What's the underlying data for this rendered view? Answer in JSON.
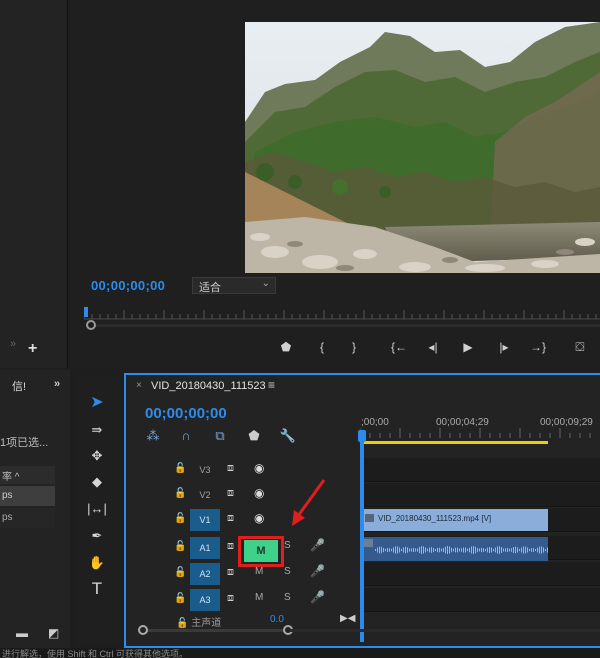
{
  "program_monitor": {
    "timecode": "00;00;00;00",
    "fit_label": "适合",
    "transport": [
      "marker-icon",
      "in-point-icon",
      "out-point-icon",
      "go-to-in-icon",
      "step-back-icon",
      "play-icon",
      "step-forward-icon",
      "go-to-out-icon",
      "export-frame-icon"
    ]
  },
  "project_panel": {
    "title": "信!",
    "selection": "1项已选...",
    "header": "率 ^",
    "row1": "ps",
    "row2": "ps"
  },
  "timeline": {
    "sequence_name": "VID_20180430_111523",
    "timecode": "00;00;00;00",
    "ruler": [
      ";00;00",
      "00;00;04;29",
      "00;00;09;29"
    ],
    "tracks": [
      {
        "name": "V3",
        "type": "video",
        "on": false
      },
      {
        "name": "V2",
        "type": "video",
        "on": false
      },
      {
        "name": "V1",
        "type": "video",
        "on": true
      },
      {
        "name": "A1",
        "type": "audio",
        "on": true
      },
      {
        "name": "A2",
        "type": "audio",
        "on": true
      },
      {
        "name": "A3",
        "type": "audio",
        "on": true
      }
    ],
    "mute_label": "M",
    "solo_label": "S",
    "clip_video_label": "VID_20180430_111523.mp4 [V]",
    "master_label": "主声道",
    "master_value": "0.0"
  },
  "status_bar": "进行解选，使用 Shift 和 Ctrl 可获得其他选项。",
  "colors": {
    "accent": "#2d8ceb",
    "mute_active": "#3fd08a",
    "highlight": "#e01e1e",
    "clip_video": "#8aaed9",
    "clip_audio": "#355a8e"
  }
}
